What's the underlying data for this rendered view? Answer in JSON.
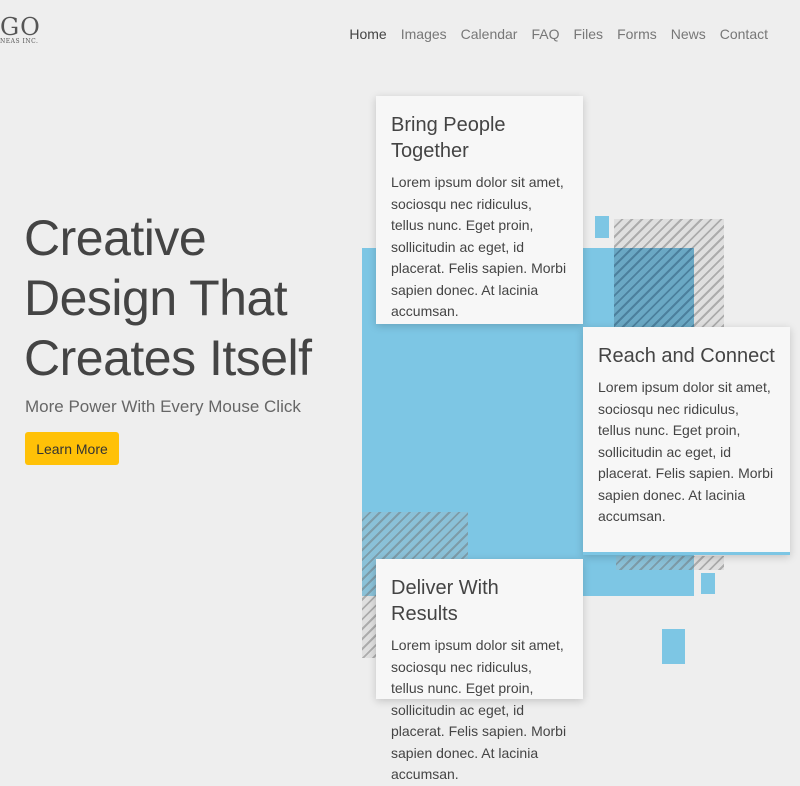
{
  "brand": {
    "logo": "GO",
    "tagline": "NEAS INC."
  },
  "nav": {
    "items": [
      {
        "label": "Home",
        "active": true
      },
      {
        "label": "Images",
        "active": false
      },
      {
        "label": "Calendar",
        "active": false
      },
      {
        "label": "FAQ",
        "active": false
      },
      {
        "label": "Files",
        "active": false
      },
      {
        "label": "Forms",
        "active": false
      },
      {
        "label": "News",
        "active": false
      },
      {
        "label": "Contact",
        "active": false
      }
    ]
  },
  "hero": {
    "title": "Creative Design That Creates Itself",
    "subtitle": "More Power With Every Mouse Click",
    "button_label": "Learn More"
  },
  "cards": [
    {
      "title": "Bring People Together",
      "text": "Lorem ipsum dolor sit amet, sociosqu nec ridiculus, tellus nunc. Eget proin, sollicitudin ac eget, id placerat. Felis sapien. Morbi sapien donec. At lacinia accumsan."
    },
    {
      "title": "Reach and Connect",
      "text": "Lorem ipsum dolor sit amet, sociosqu nec ridiculus, tellus nunc. Eget proin, sollicitudin ac eget, id placerat. Felis sapien. Morbi sapien donec. At lacinia accumsan."
    },
    {
      "title": "Deliver With Results",
      "text": "Lorem ipsum dolor sit amet, sociosqu nec ridiculus, tellus nunc. Eget proin, sollicitudin ac eget, id placerat. Felis sapien. Morbi sapien donec. At lacinia accumsan."
    }
  ],
  "colors": {
    "accent_yellow": "#ffc107",
    "accent_blue": "#7dc6e4",
    "background": "#eeeeee"
  }
}
